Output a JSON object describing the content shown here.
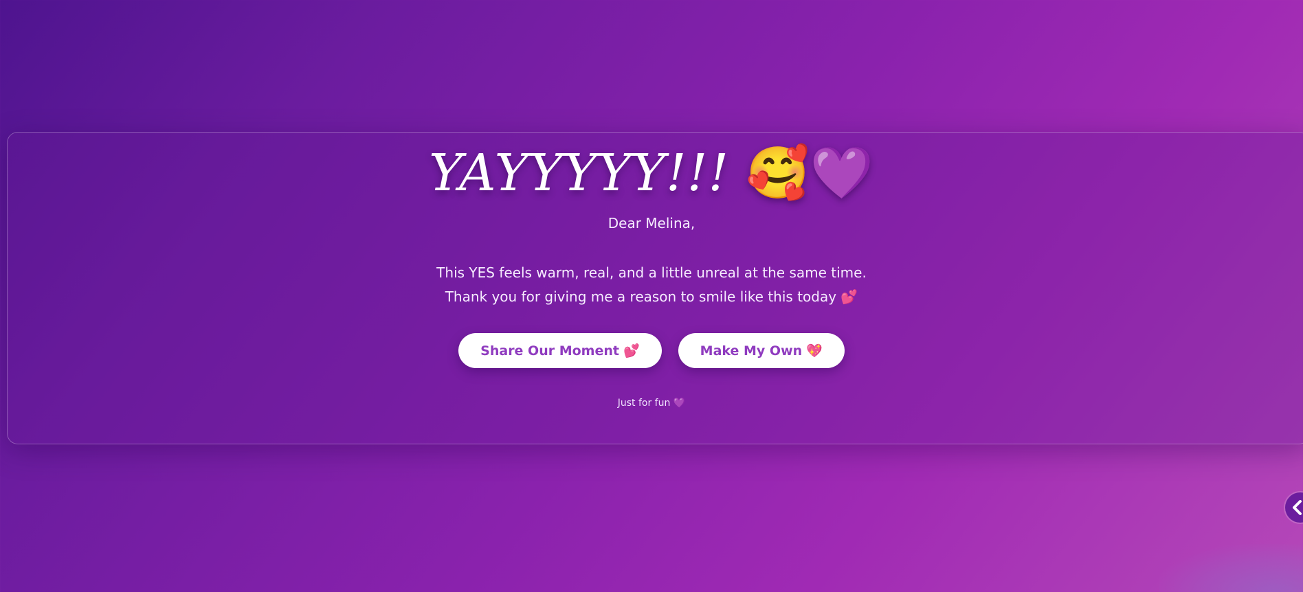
{
  "hero": {
    "title": "YAYYYYY!!!",
    "title_emojis": "🥰💜"
  },
  "letter": {
    "greeting": "Dear Melina,",
    "line1": "This YES feels warm, real, and a little unreal at the same time.",
    "line2": "Thank you for giving me a reason to smile like this today 💕"
  },
  "actions": {
    "share_label": "Share Our Moment",
    "share_emoji": "💕",
    "make_label": "Make My Own",
    "make_emoji": "💖"
  },
  "footer": {
    "note": "Just for fun 💜"
  },
  "sidebar_toggle": {
    "icon": "chevron-left-icon"
  },
  "colors": {
    "background_start": "#4e148f",
    "background_end": "#b548b8",
    "button_text": "#8f3bbf",
    "button_bg": "#ffffff",
    "text": "#ffffff"
  }
}
